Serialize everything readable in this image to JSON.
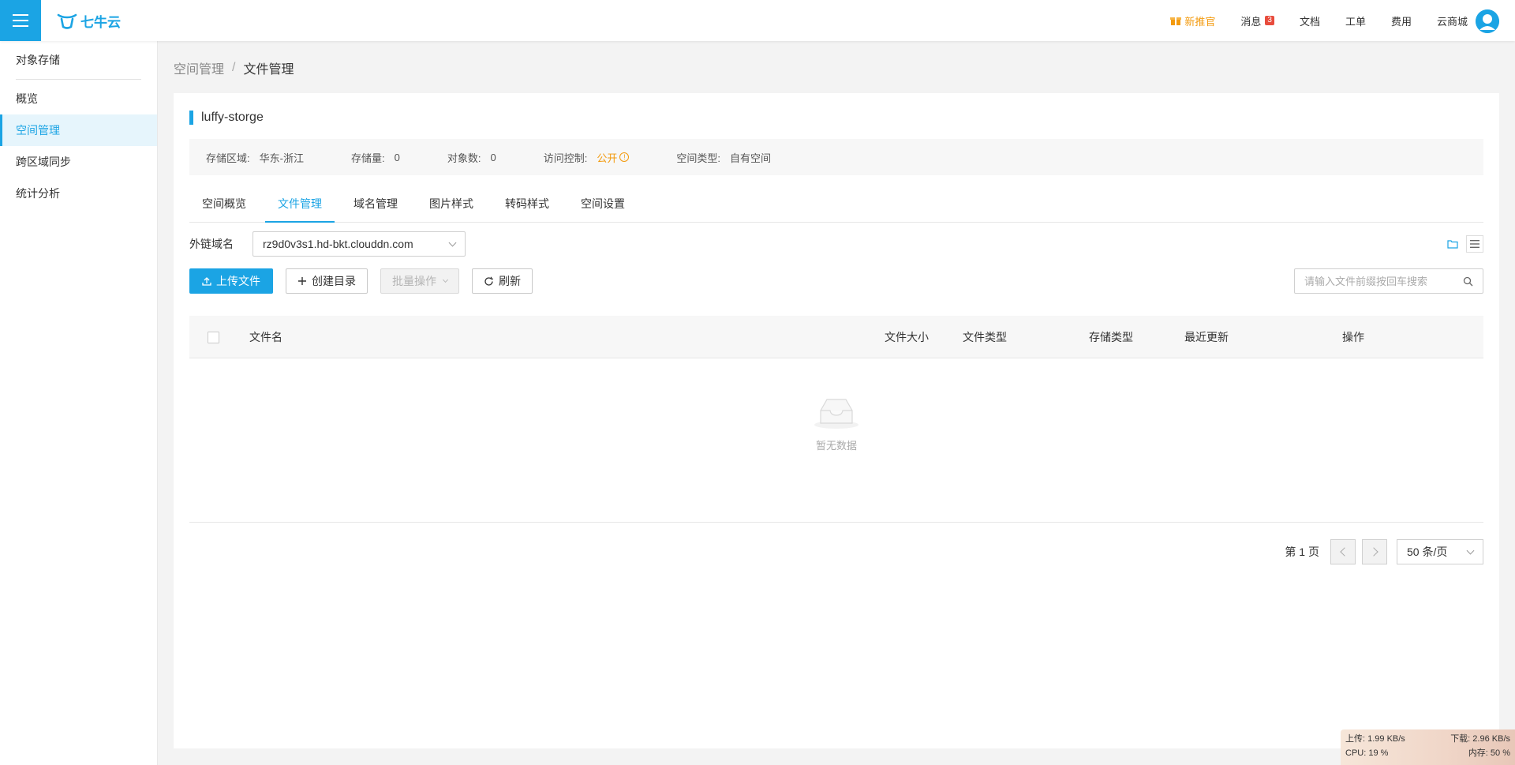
{
  "header": {
    "logo_text": "七牛云",
    "nav": [
      {
        "label": "新推官",
        "highlight": true
      },
      {
        "label": "消息",
        "badge": "3"
      },
      {
        "label": "文档"
      },
      {
        "label": "工单"
      },
      {
        "label": "费用"
      },
      {
        "label": "云商城"
      }
    ]
  },
  "sidebar": {
    "title": "对象存储",
    "items": [
      {
        "label": "概览",
        "active": false
      },
      {
        "label": "空间管理",
        "active": true
      },
      {
        "label": "跨区域同步",
        "active": false
      },
      {
        "label": "统计分析",
        "active": false
      }
    ]
  },
  "breadcrumb": {
    "parent": "空间管理",
    "separator": "/",
    "current": "文件管理"
  },
  "bucket": {
    "name": "luffy-storge",
    "info": [
      {
        "label": "存储区域:",
        "value": "华东-浙江"
      },
      {
        "label": "存储量:",
        "value": "0"
      },
      {
        "label": "对象数:",
        "value": "0"
      },
      {
        "label": "访问控制:",
        "value": "公开"
      },
      {
        "label": "空间类型:",
        "value": "自有空间"
      }
    ]
  },
  "tabs": [
    {
      "label": "空间概览",
      "active": false
    },
    {
      "label": "文件管理",
      "active": true
    },
    {
      "label": "域名管理",
      "active": false
    },
    {
      "label": "图片样式",
      "active": false
    },
    {
      "label": "转码样式",
      "active": false
    },
    {
      "label": "空间设置",
      "active": false
    }
  ],
  "domain": {
    "label": "外链域名",
    "value": "rz9d0v3s1.hd-bkt.clouddn.com"
  },
  "actions": {
    "upload": "上传文件",
    "mkdir": "创建目录",
    "batch": "批量操作",
    "refresh": "刷新"
  },
  "search": {
    "placeholder": "请输入文件前缀按回车搜索"
  },
  "table": {
    "columns": [
      "文件名",
      "文件大小",
      "文件类型",
      "存储类型",
      "最近更新",
      "操作"
    ],
    "rows": [],
    "empty_text": "暂无数据"
  },
  "pagination": {
    "page_label": "第 1 页",
    "page_size": "50 条/页"
  },
  "netmon": {
    "upload": "上传: 1.99 KB/s",
    "download": "下载: 2.96 KB/s",
    "cpu": "CPU: 19 %",
    "memory": "内存: 50 %"
  },
  "colors": {
    "accent": "#1ba4e4",
    "warning": "#f39a0e",
    "badge": "#e84c3d"
  }
}
